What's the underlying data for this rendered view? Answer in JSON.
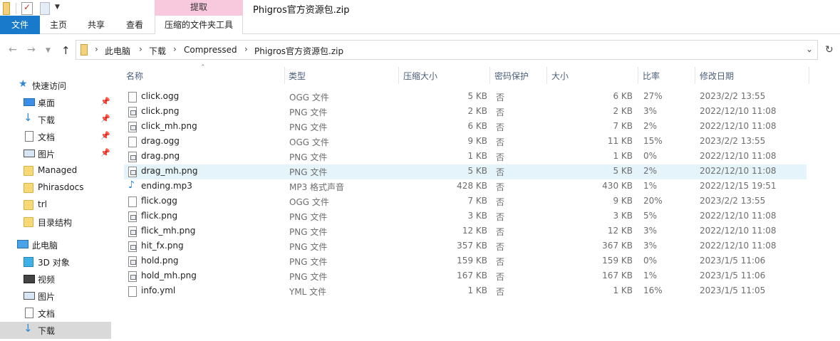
{
  "window": {
    "title": "Phigros官方资源包.zip",
    "context_tab": "提取"
  },
  "ribbon": {
    "tabs": [
      "文件",
      "主页",
      "共享",
      "查看",
      "压缩的文件夹工具"
    ]
  },
  "address": {
    "crumbs": [
      "此电脑",
      "下载",
      "Compressed",
      "Phigros官方资源包.zip"
    ]
  },
  "sidebar": {
    "items": [
      {
        "label": "快速访问",
        "icon": "star-icon"
      },
      {
        "label": "桌面",
        "icon": "desktop-icon",
        "pinned": true
      },
      {
        "label": "下载",
        "icon": "download-icon",
        "pinned": true
      },
      {
        "label": "文档",
        "icon": "documents-icon",
        "pinned": true
      },
      {
        "label": "图片",
        "icon": "pictures-icon",
        "pinned": true
      },
      {
        "label": "Managed",
        "icon": "folder-icon"
      },
      {
        "label": "Phirasdocs",
        "icon": "folder-icon"
      },
      {
        "label": "trl",
        "icon": "folder-icon"
      },
      {
        "label": "目录结构",
        "icon": "folder-icon"
      },
      {
        "label": "此电脑",
        "icon": "this-pc-icon"
      },
      {
        "label": "3D 对象",
        "icon": "3d-objects-icon"
      },
      {
        "label": "视频",
        "icon": "videos-icon"
      },
      {
        "label": "图片",
        "icon": "pictures-icon"
      },
      {
        "label": "文档",
        "icon": "documents-icon"
      },
      {
        "label": "下载",
        "icon": "download-icon",
        "selected": true
      }
    ]
  },
  "columns": {
    "name": "名称",
    "type": "类型",
    "compressed_size": "压缩大小",
    "password": "密码保护",
    "size": "大小",
    "ratio": "比率",
    "modified": "修改日期"
  },
  "files": [
    {
      "name": "click.ogg",
      "type": "OGG 文件",
      "csize": "5 KB",
      "pwd": "否",
      "size": "6 KB",
      "ratio": "27%",
      "date": "2023/2/2 13:55",
      "kind": "file"
    },
    {
      "name": "click.png",
      "type": "PNG 文件",
      "csize": "2 KB",
      "pwd": "否",
      "size": "2 KB",
      "ratio": "3%",
      "date": "2022/12/10 11:08",
      "kind": "png"
    },
    {
      "name": "click_mh.png",
      "type": "PNG 文件",
      "csize": "6 KB",
      "pwd": "否",
      "size": "7 KB",
      "ratio": "2%",
      "date": "2022/12/10 11:08",
      "kind": "png"
    },
    {
      "name": "drag.ogg",
      "type": "OGG 文件",
      "csize": "9 KB",
      "pwd": "否",
      "size": "11 KB",
      "ratio": "15%",
      "date": "2023/2/2 13:55",
      "kind": "file"
    },
    {
      "name": "drag.png",
      "type": "PNG 文件",
      "csize": "1 KB",
      "pwd": "否",
      "size": "1 KB",
      "ratio": "0%",
      "date": "2022/12/10 11:08",
      "kind": "png"
    },
    {
      "name": "drag_mh.png",
      "type": "PNG 文件",
      "csize": "5 KB",
      "pwd": "否",
      "size": "5 KB",
      "ratio": "2%",
      "date": "2022/12/10 11:08",
      "kind": "png",
      "hover": true
    },
    {
      "name": "ending.mp3",
      "type": "MP3 格式声音",
      "csize": "428 KB",
      "pwd": "否",
      "size": "430 KB",
      "ratio": "1%",
      "date": "2022/12/15 19:51",
      "kind": "mp3"
    },
    {
      "name": "flick.ogg",
      "type": "OGG 文件",
      "csize": "7 KB",
      "pwd": "否",
      "size": "9 KB",
      "ratio": "20%",
      "date": "2023/2/2 13:55",
      "kind": "file"
    },
    {
      "name": "flick.png",
      "type": "PNG 文件",
      "csize": "3 KB",
      "pwd": "否",
      "size": "3 KB",
      "ratio": "5%",
      "date": "2022/12/10 11:08",
      "kind": "png"
    },
    {
      "name": "flick_mh.png",
      "type": "PNG 文件",
      "csize": "12 KB",
      "pwd": "否",
      "size": "12 KB",
      "ratio": "3%",
      "date": "2022/12/10 11:08",
      "kind": "png"
    },
    {
      "name": "hit_fx.png",
      "type": "PNG 文件",
      "csize": "357 KB",
      "pwd": "否",
      "size": "367 KB",
      "ratio": "3%",
      "date": "2022/12/10 11:08",
      "kind": "png"
    },
    {
      "name": "hold.png",
      "type": "PNG 文件",
      "csize": "159 KB",
      "pwd": "否",
      "size": "159 KB",
      "ratio": "0%",
      "date": "2023/1/5 11:06",
      "kind": "png"
    },
    {
      "name": "hold_mh.png",
      "type": "PNG 文件",
      "csize": "167 KB",
      "pwd": "否",
      "size": "167 KB",
      "ratio": "1%",
      "date": "2023/1/5 11:06",
      "kind": "png"
    },
    {
      "name": "info.yml",
      "type": "YML 文件",
      "csize": "1 KB",
      "pwd": "否",
      "size": "1 KB",
      "ratio": "16%",
      "date": "2023/1/5 11:05",
      "kind": "file"
    }
  ],
  "colors": {
    "accent": "#1979ca",
    "context_tab": "#f8c9dd",
    "hover_row": "#e5f3fb",
    "selected_nav": "#d9d9d9"
  }
}
